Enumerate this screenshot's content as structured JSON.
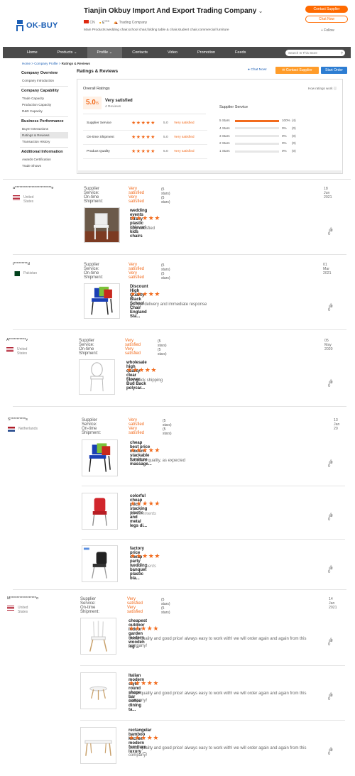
{
  "header": {
    "logo_text": "OK-BUY",
    "company_name": "Tianjin Okbuy Import And Export Trading Company",
    "country_code": "CN",
    "years": "5",
    "years_suffix": "YRS",
    "company_type": "Trading Company",
    "main_products": "Main Products:wedding chair,school chair,folding table & chair,student chair,commercial furniture",
    "contact_supplier": "Contact Supplier",
    "chat_now": "Chat Now",
    "follow": "Follow"
  },
  "nav": {
    "items": [
      "Home",
      "Products",
      "Profile",
      "Contacts",
      "Video",
      "Promotion",
      "Feeds"
    ],
    "search_placeholder": "Search In This Store"
  },
  "breadcrumb": {
    "home": "Home",
    "profile": "Company Profile",
    "current": "Ratings & Reviews",
    "sep": ">"
  },
  "sidebar": {
    "overview": {
      "title": "Company Overview",
      "items": [
        "Company Introduction"
      ]
    },
    "capability": {
      "title": "Company Capability",
      "items": [
        "Trade Capacity",
        "Production Capacity",
        "R&D Capacity"
      ]
    },
    "business": {
      "title": "Business Performance",
      "items": [
        "Buyer Interactions",
        "Ratings & Reviews",
        "Transaction History"
      ]
    },
    "additional": {
      "title": "Additional Information",
      "items": [
        "Awards Certification",
        "Trade Shows"
      ]
    }
  },
  "ratings": {
    "title": "Ratings & Reviews",
    "chat_now": "Chat Now!",
    "contact_supplier": "Contact Supplier",
    "start_order": "Start Order",
    "overall_label": "Overall Ratings",
    "how_ratings_work": "How ratings work",
    "score": "5.0",
    "score_max": "/5",
    "score_text": "Very satisfied",
    "review_count": "4 Reviews",
    "categories": [
      {
        "label": "Supplier Service",
        "score": "5.0",
        "text": "Very satisfied"
      },
      {
        "label": "On-time Shipment",
        "score": "5.0",
        "text": "Very satisfied"
      },
      {
        "label": "Product Quality",
        "score": "5.0",
        "text": "Very satisfied"
      }
    ],
    "supplier_service_title": "Supplier Service",
    "distribution": [
      {
        "label": "5 Stars",
        "percent": "100%",
        "count": "(4)",
        "fill": 1.0
      },
      {
        "label": "4 Stars",
        "percent": "0%",
        "count": "(0)",
        "fill": 0
      },
      {
        "label": "3 Stars",
        "percent": "0%",
        "count": "(0)",
        "fill": 0
      },
      {
        "label": "2 Stars",
        "percent": "0%",
        "count": "(0)",
        "fill": 0
      },
      {
        "label": "1 Stars",
        "percent": "0%",
        "count": "(0)",
        "fill": 0
      }
    ]
  },
  "review_labels": {
    "supplier_service": "Supplier Service:",
    "ontime_shipment": "On-time Shipment:",
    "very_satisfied": "Very satisfied",
    "five_stars": "(5 stars)"
  },
  "reviews": [
    {
      "user": "a************************e",
      "country": "United States",
      "flag": "us",
      "date": "18 Jun 2021",
      "products": [
        {
          "name": "wedding events tiffany plastic chiavari kids chairs",
          "comment": "very satisfied",
          "likes": "0",
          "img": "wood-chair"
        }
      ]
    },
    {
      "user": "t*********d",
      "country": "Pakistan",
      "flag": "pk",
      "date": "01 Mar 2021",
      "products": [
        {
          "name": "Discount High Quality Black School Chair England Sta...",
          "comment": "prompt delivery and immediate response",
          "likes": "0",
          "img": "stack-chairs"
        }
      ]
    },
    {
      "user": "A***********v",
      "country": "United States",
      "flag": "us",
      "date": "05 May 2020",
      "products": [
        {
          "name": "wholesale high quality clear Flower Bud Back polycar...",
          "comment": "very quick shipping",
          "likes": "0",
          "img": "clear-chair"
        }
      ]
    },
    {
      "user": "S**********s",
      "country": "Netherlands",
      "flag": "nl",
      "date": "13 Jan 20",
      "products": [
        {
          "name": "cheap best price modern stackable furniture massage...",
          "comment": "excellent quality, as expected",
          "likes": "0",
          "img": "stack-chairs"
        },
        {
          "name": "colorful cheap price stacking plastic and metal legs di...",
          "comment": "No comments",
          "likes": "0",
          "img": "red-chair",
          "italic": true
        },
        {
          "name": "factory price cheap party wedding banquet plastic bla...",
          "comment": "No comments",
          "likes": "0",
          "img": "black-chair",
          "italic": true
        }
      ]
    },
    {
      "user": "M*****************o",
      "country": "United States",
      "flag": "us",
      "date": "14 Jan 2021",
      "products": [
        {
          "name": "cheapest outdoor indoor garden modern wooden leg ...",
          "comment": "Great quality and good price! always easy to work with! we will order again and again from this company!",
          "likes": "0",
          "img": "white-chair"
        },
        {
          "name": "Italian modern style round shape bar coffee dining ta...",
          "comment": "Great quality and good price! always easy to work with! we will order again and again from this company!",
          "likes": "0",
          "img": "round-table"
        },
        {
          "name": "rectangelar bamboo kitchen modern furniture luxury ...",
          "comment": "Great quality and good price! always easy to work with! we will order again and again from this company!",
          "likes": "0",
          "img": "rect-table"
        }
      ]
    }
  ]
}
